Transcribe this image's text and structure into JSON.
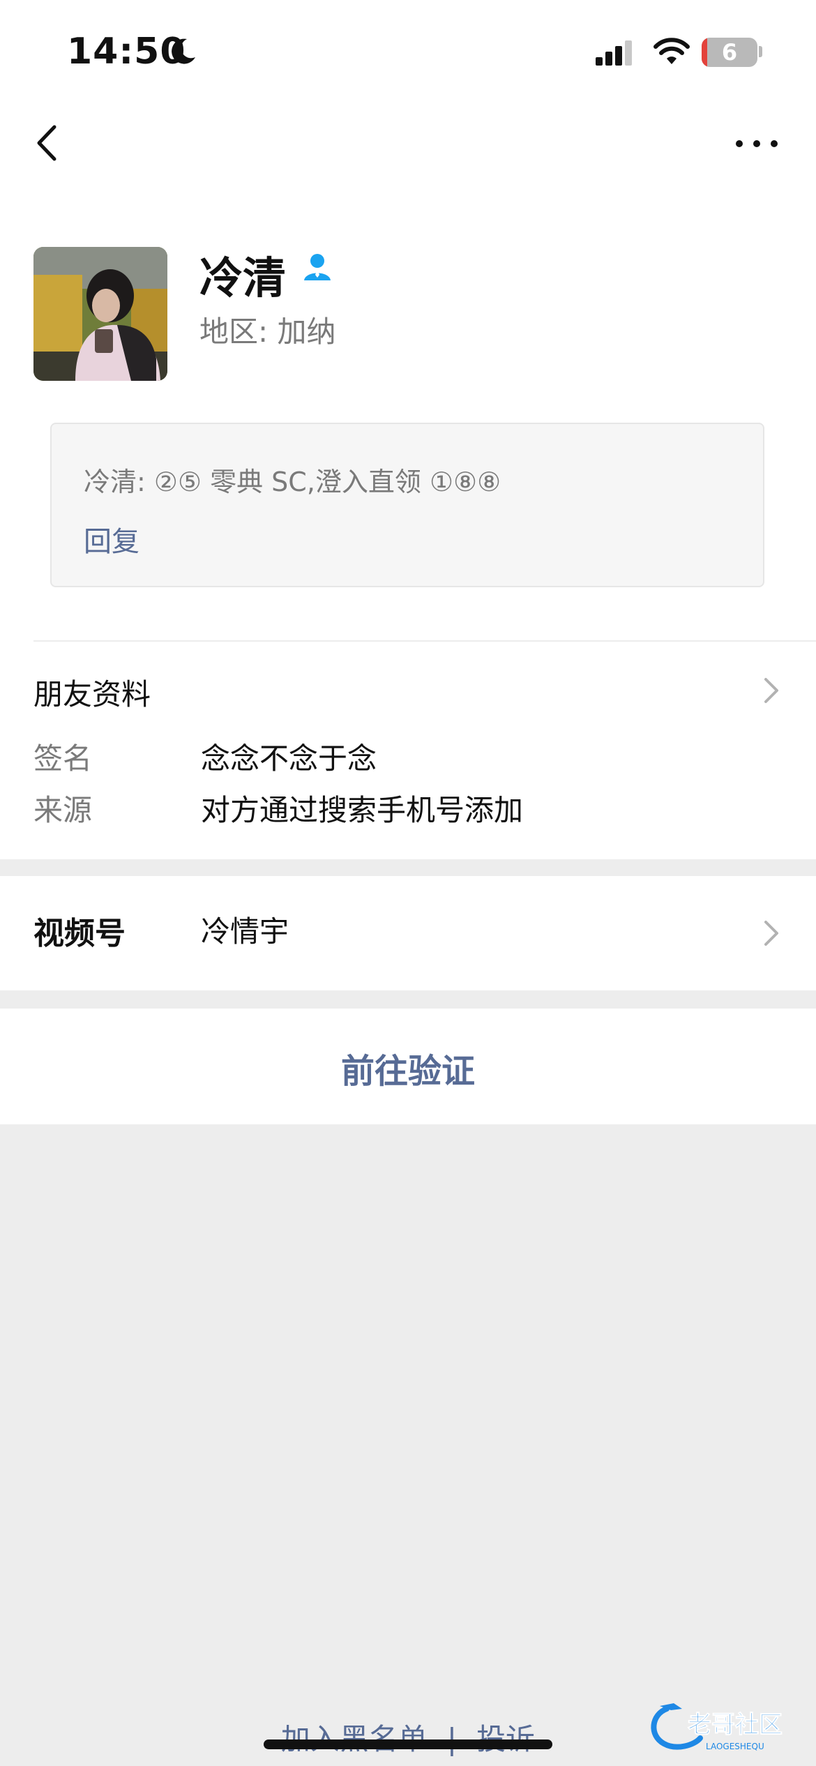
{
  "status_bar": {
    "time": "14:50",
    "battery": "6"
  },
  "profile": {
    "name": "冷清",
    "region": "地区: 加纳"
  },
  "message": {
    "text": "冷清: ②⑤ 零典 SC,澄入直领 ①⑧⑧",
    "reply": "回复"
  },
  "friend_info": {
    "title": "朋友资料",
    "signature_label": "签名",
    "signature_value": "念念不念于念",
    "source_label": "来源",
    "source_value": "对方通过搜索手机号添加"
  },
  "video": {
    "label": "视频号",
    "value": "冷情宇"
  },
  "verify_button": "前往验证",
  "bottom": {
    "blacklist": "加入黑名单",
    "separator": "|",
    "report": "投诉"
  },
  "watermark": {
    "title": "老哥社区",
    "subtitle": "LAOGESHEQU"
  },
  "colors": {
    "link": "#576b95",
    "background": "#ededed",
    "badge": "#1aa3f0"
  }
}
